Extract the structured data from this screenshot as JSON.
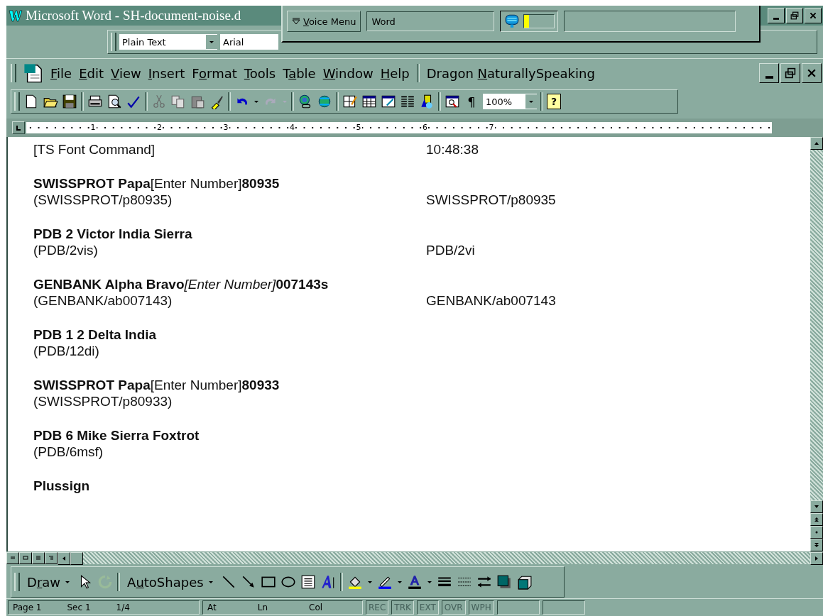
{
  "window": {
    "title": "Microsoft Word - SH-document-noise.d"
  },
  "voice_bar": {
    "menu_button": "Voice Menu",
    "field": "Word",
    "mic": {
      "level": 0.15
    }
  },
  "formatting_toolbar": {
    "style": "Plain Text",
    "font": "Arial"
  },
  "menu_bar": {
    "items": [
      {
        "label": "File"
      },
      {
        "label": "Edit"
      },
      {
        "label": "View"
      },
      {
        "label": "Insert"
      },
      {
        "label": "Format"
      },
      {
        "label": "Tools"
      },
      {
        "label": "Table"
      },
      {
        "label": "Window"
      },
      {
        "label": "Help"
      }
    ],
    "dragon": {
      "label": "Dragon NaturallySpeaking"
    }
  },
  "standard_toolbar": {
    "show_marks": "¶",
    "zoom": "100%",
    "help": "?"
  },
  "ruler": {
    "numbers": [
      "1",
      "2",
      "3",
      "4",
      "5",
      "6",
      "7"
    ]
  },
  "document": {
    "entries": [
      {
        "segments": [
          {
            "text": "[TS Font Command]",
            "kind": "plain"
          }
        ],
        "right": "10:48:38"
      },
      {
        "segments": [
          {
            "text": "SWISSPROT Papa",
            "kind": "bold"
          },
          {
            "text": "[Enter Number]",
            "kind": "plain"
          },
          {
            "text": "80935",
            "kind": "bold"
          }
        ],
        "code": "(SWISSPROT/p80935)",
        "right": "SWISSPROT/p80935"
      },
      {
        "segments": [
          {
            "text": "PDB 2 Victor India Sierra",
            "kind": "bold"
          }
        ],
        "code": "(PDB/2vis)",
        "right": "PDB/2vi"
      },
      {
        "segments": [
          {
            "text": "GENBANK Alpha Bravo",
            "kind": "bold"
          },
          {
            "text": "[Enter Number]",
            "kind": "italic"
          },
          {
            "text": "007143s",
            "kind": "bold"
          }
        ],
        "code": "(GENBANK/ab007143)",
        "right": "GENBANK/ab007143"
      },
      {
        "segments": [
          {
            "text": "PDB 1 2 Delta India",
            "kind": "bold"
          }
        ],
        "code": "(PDB/12di)"
      },
      {
        "segments": [
          {
            "text": "SWISSPROT Papa",
            "kind": "bold"
          },
          {
            "text": "[Enter Number]",
            "kind": "plain"
          },
          {
            "text": "80933",
            "kind": "bold"
          }
        ],
        "code": "(SWISSPROT/p80933)"
      },
      {
        "segments": [
          {
            "text": "PDB 6 Mike Sierra Foxtrot",
            "kind": "bold"
          }
        ],
        "code": "(PDB/6msf)"
      },
      {
        "segments": [
          {
            "text": "Plussign",
            "kind": "bold"
          }
        ]
      }
    ]
  },
  "drawing_toolbar": {
    "draw": "Draw",
    "autoshapes": "AutoShapes"
  },
  "status_bar": {
    "fields": [
      {
        "label": "Page 1"
      },
      {
        "label": "Sec 1"
      },
      {
        "label": "1/4"
      },
      {
        "label": "At"
      },
      {
        "label": "Ln"
      },
      {
        "label": "Col"
      }
    ],
    "modes": [
      {
        "label": "REC",
        "on": false
      },
      {
        "label": "TRK",
        "on": false
      },
      {
        "label": "EXT",
        "on": false
      },
      {
        "label": "OVR",
        "on": false
      },
      {
        "label": "WPH",
        "on": false
      }
    ]
  }
}
